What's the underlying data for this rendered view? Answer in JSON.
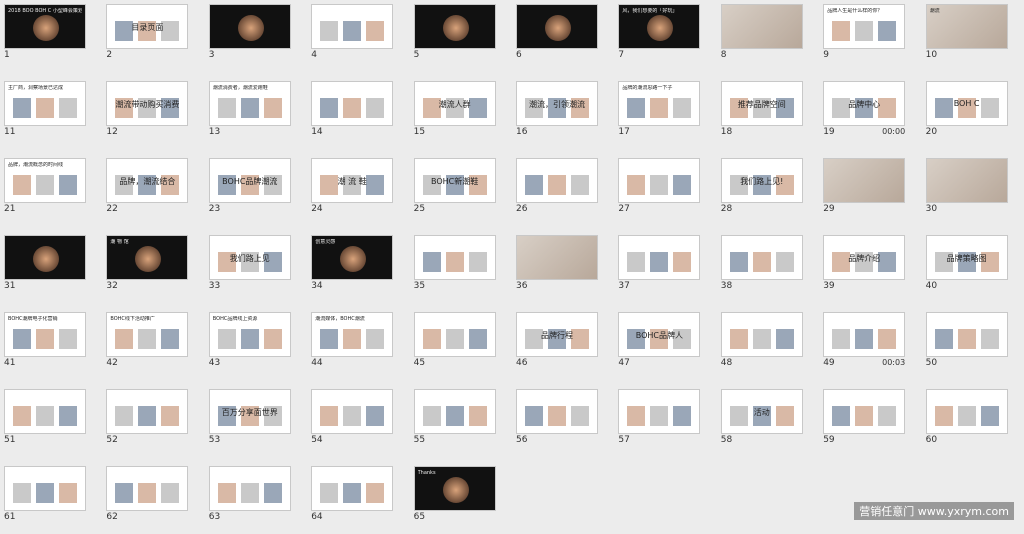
{
  "window": {
    "title": ""
  },
  "slides": [
    {
      "n": "1",
      "theme": "dark",
      "title": "2018 BOO BOH C  小型峰会策划方案"
    },
    {
      "n": "2",
      "theme": "white",
      "title": "目录页面"
    },
    {
      "n": "3",
      "theme": "dark",
      "title": ""
    },
    {
      "n": "4",
      "theme": "white",
      "title": ""
    },
    {
      "n": "5",
      "theme": "dark",
      "title": ""
    },
    {
      "n": "6",
      "theme": "dark",
      "title": ""
    },
    {
      "n": "7",
      "theme": "dark",
      "title": "风，我们想要的「好玩」"
    },
    {
      "n": "8",
      "theme": "photo",
      "title": ""
    },
    {
      "n": "9",
      "theme": "white",
      "title": "品牌人生是什么样的你？"
    },
    {
      "n": "10",
      "theme": "photo",
      "title": "潮流"
    },
    {
      "n": "11",
      "theme": "white",
      "title": "主厂商，洞察场景已达成"
    },
    {
      "n": "12",
      "theme": "white",
      "title": "潮流带动购买消费"
    },
    {
      "n": "13",
      "theme": "white",
      "title": "潮流消费者，潮流爱跑鞋"
    },
    {
      "n": "14",
      "theme": "white",
      "title": ""
    },
    {
      "n": "15",
      "theme": "white",
      "title": "潮流人群"
    },
    {
      "n": "16",
      "theme": "white",
      "title": "潮流，引领潮流"
    },
    {
      "n": "17",
      "theme": "white",
      "title": "品牌的潮流思路一下子"
    },
    {
      "n": "18",
      "theme": "white",
      "title": "推荐品牌空间"
    },
    {
      "n": "19",
      "theme": "white",
      "title": "品牌中心",
      "time": "00:00"
    },
    {
      "n": "20",
      "theme": "white",
      "title": "BOH C"
    },
    {
      "n": "21",
      "theme": "white",
      "title": "品牌，潮流概念的时间线"
    },
    {
      "n": "22",
      "theme": "white",
      "title": "品牌，潮流结合"
    },
    {
      "n": "23",
      "theme": "white",
      "title": "BOHC品牌潮流"
    },
    {
      "n": "24",
      "theme": "white",
      "title": "潮 流 鞋"
    },
    {
      "n": "25",
      "theme": "white",
      "title": "BOHC新潮鞋"
    },
    {
      "n": "26",
      "theme": "white",
      "title": ""
    },
    {
      "n": "27",
      "theme": "white",
      "title": ""
    },
    {
      "n": "28",
      "theme": "white",
      "title": "我们路上见!"
    },
    {
      "n": "29",
      "theme": "photo",
      "title": ""
    },
    {
      "n": "30",
      "theme": "photo",
      "title": ""
    },
    {
      "n": "31",
      "theme": "dark",
      "title": ""
    },
    {
      "n": "32",
      "theme": "dark",
      "title": "潮 物 馆"
    },
    {
      "n": "33",
      "theme": "white",
      "title": "我们路上见"
    },
    {
      "n": "34",
      "theme": "dark",
      "title": "创意灵感"
    },
    {
      "n": "35",
      "theme": "white",
      "title": ""
    },
    {
      "n": "36",
      "theme": "photo",
      "title": ""
    },
    {
      "n": "37",
      "theme": "white",
      "title": ""
    },
    {
      "n": "38",
      "theme": "white",
      "title": ""
    },
    {
      "n": "39",
      "theme": "white",
      "title": "品牌介绍"
    },
    {
      "n": "40",
      "theme": "white",
      "title": "品牌策略图"
    },
    {
      "n": "41",
      "theme": "white",
      "title": "BOHC潮牌电子化营销"
    },
    {
      "n": "42",
      "theme": "white",
      "title": "BOHC线下活动推广"
    },
    {
      "n": "43",
      "theme": "white",
      "title": "BOHC品牌线上资源"
    },
    {
      "n": "44",
      "theme": "white",
      "title": "潮流媒体，BOHC潮流"
    },
    {
      "n": "45",
      "theme": "white",
      "title": ""
    },
    {
      "n": "46",
      "theme": "white",
      "title": "品牌行程"
    },
    {
      "n": "47",
      "theme": "white",
      "title": "BOHC品牌人"
    },
    {
      "n": "48",
      "theme": "white",
      "title": ""
    },
    {
      "n": "49",
      "theme": "white",
      "title": "",
      "time": "00:03"
    },
    {
      "n": "50",
      "theme": "white",
      "title": ""
    },
    {
      "n": "51",
      "theme": "white",
      "title": ""
    },
    {
      "n": "52",
      "theme": "white",
      "title": ""
    },
    {
      "n": "53",
      "theme": "white",
      "title": "百万分享面世界"
    },
    {
      "n": "54",
      "theme": "white",
      "title": ""
    },
    {
      "n": "55",
      "theme": "white",
      "title": ""
    },
    {
      "n": "56",
      "theme": "white",
      "title": ""
    },
    {
      "n": "57",
      "theme": "white",
      "title": ""
    },
    {
      "n": "58",
      "theme": "white",
      "title": "活动"
    },
    {
      "n": "59",
      "theme": "white",
      "title": ""
    },
    {
      "n": "60",
      "theme": "white",
      "title": ""
    },
    {
      "n": "61",
      "theme": "white",
      "title": ""
    },
    {
      "n": "62",
      "theme": "white",
      "title": ""
    },
    {
      "n": "63",
      "theme": "white",
      "title": ""
    },
    {
      "n": "64",
      "theme": "white",
      "title": ""
    },
    {
      "n": "65",
      "theme": "dark",
      "title": "Thanks"
    }
  ],
  "watermark": "营销任意门 www.yxrym.com",
  "colors": {
    "selected": "#e07a1f",
    "dark": "#1a1a1a"
  }
}
